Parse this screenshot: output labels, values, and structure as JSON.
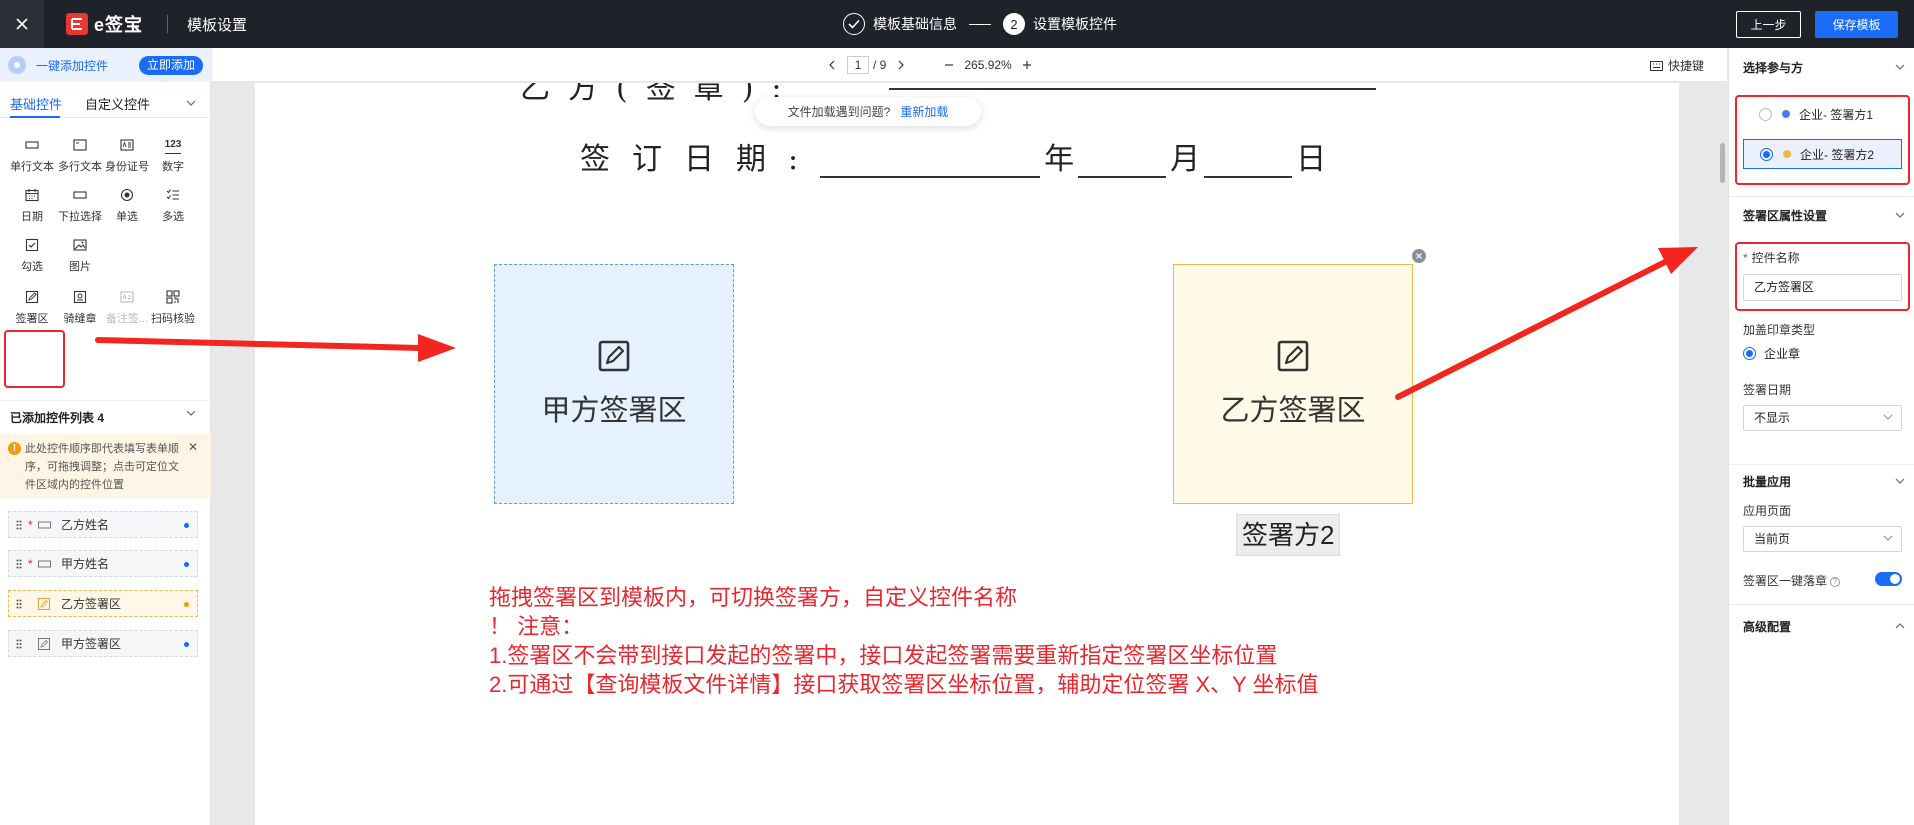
{
  "header": {
    "close_icon": "close-icon",
    "logo_text": "e签宝",
    "title": "模板设置",
    "steps": [
      {
        "label": "模板基础信息",
        "state": "done"
      },
      {
        "number": "2",
        "label": "设置模板控件",
        "state": "current"
      }
    ],
    "prev_label": "上一步",
    "save_label": "保存模板"
  },
  "left_panel": {
    "quick_add_label": "一键添加控件",
    "quick_add_button": "立即添加",
    "tabs": [
      {
        "label": "基础控件",
        "active": true
      },
      {
        "label": "自定义控件",
        "active": false
      }
    ],
    "controls": [
      {
        "label": "单行文本",
        "icon": "single-line-text-icon"
      },
      {
        "label": "多行文本",
        "icon": "multi-line-text-icon"
      },
      {
        "label": "身份证号",
        "icon": "id-card-icon"
      },
      {
        "label": "数字",
        "icon": "number-icon",
        "glyph": "123"
      },
      {
        "label": "日期",
        "icon": "calendar-icon"
      },
      {
        "label": "下拉选择",
        "icon": "dropdown-icon"
      },
      {
        "label": "单选",
        "icon": "radio-icon"
      },
      {
        "label": "多选",
        "icon": "checklist-icon"
      },
      {
        "label": "勾选",
        "icon": "checkbox-icon"
      },
      {
        "label": "图片",
        "icon": "image-icon"
      },
      {
        "label": "签署区",
        "icon": "sign-area-icon"
      },
      {
        "label": "骑缝章",
        "icon": "seam-seal-icon"
      },
      {
        "label": "备注签...",
        "icon": "remark-sign-icon",
        "disabled": true
      },
      {
        "label": "扫码核验",
        "icon": "qr-scan-icon"
      }
    ],
    "added_list_title": "已添加控件列表 4",
    "notice": "此处控件顺序即代表填写表单顺序，可拖拽调整；点击可定位文件区域内的控件位置",
    "added_items": [
      {
        "label": "乙方姓名",
        "required": "*",
        "dot": "#1a6cf6",
        "active": false
      },
      {
        "label": "甲方姓名",
        "required": "*",
        "dot": "#1a6cf6",
        "active": false
      },
      {
        "label": "乙方签署区",
        "required": "",
        "dot": "#f29b0d",
        "active": true
      },
      {
        "label": "甲方签署区",
        "required": "",
        "dot": "#1a6cf6",
        "active": false
      }
    ]
  },
  "toolbar": {
    "page_current": "1",
    "page_total": "/ 9",
    "zoom": "265.92%",
    "shortcut_label": "快捷键"
  },
  "document": {
    "top_label": "乙方(签章):",
    "reload_text": "文件加载遇到问题?",
    "reload_link": "重新加载",
    "date_label": "签订日期:",
    "date_units": [
      "年",
      "月",
      "日"
    ],
    "sign_a_label": "甲方签署区",
    "sign_b_label": "乙方签署区",
    "party_tag": "签署方2",
    "annotation_lines": [
      "拖拽签署区到模板内，可切换签署方，自定义控件名称",
      "！ 注意：",
      "1.签署区不会带到接口发起的签署中，接口发起签署需要重新指定签署区坐标位置",
      "2.可通过【查询模板文件详情】接口获取签署区坐标位置，辅助定位签署 X、Y 坐标值"
    ]
  },
  "right_panel": {
    "party_section": "选择参与方",
    "parties": [
      {
        "label": "企业- 签署方1",
        "color": "#4a7de8",
        "selected": false
      },
      {
        "label": "企业- 签署方2",
        "color": "#f0b84a",
        "selected": true
      }
    ],
    "props_section": "签署区属性设置",
    "name_label": "控件名称",
    "name_required": "*",
    "name_value": "乙方签署区",
    "seal_type_label": "加盖印章类型",
    "seal_type_value": "企业章",
    "sign_date_label": "签署日期",
    "sign_date_value": "不显示",
    "batch_section": "批量应用",
    "apply_page_label": "应用页面",
    "apply_page_value": "当前页",
    "one_click_label": "签署区一键落章",
    "one_click_on": true,
    "advanced_section": "高级配置"
  },
  "colors": {
    "accent": "#1a6cf6",
    "annotation_red": "#e8272e",
    "sign_a_bg": "#e5f2fd",
    "sign_b_bg": "#fff9e8"
  }
}
